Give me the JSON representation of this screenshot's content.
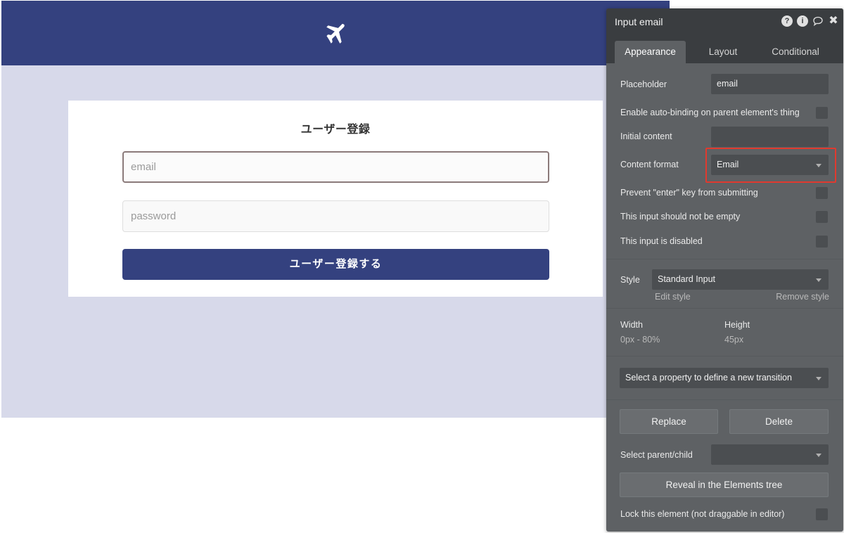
{
  "page": {
    "card_title": "ユーザー登録",
    "email_placeholder": "email",
    "password_placeholder": "password",
    "submit_label": "ユーザー登録する"
  },
  "panel": {
    "title": "Input email",
    "icons": [
      "question-icon",
      "info-icon",
      "comment-icon",
      "close-icon"
    ],
    "tabs": [
      "Appearance",
      "Layout",
      "Conditional"
    ],
    "active_tab": "Appearance",
    "placeholder_label": "Placeholder",
    "placeholder_value": "email",
    "auto_binding_label": "Enable auto-binding on parent element's thing",
    "initial_content_label": "Initial content",
    "initial_content_value": "",
    "content_format_label": "Content format",
    "content_format_value": "Email",
    "prevent_enter_label": "Prevent \"enter\" key from submitting",
    "not_empty_label": "This input should not be empty",
    "disabled_label": "This input is disabled",
    "style_label": "Style",
    "style_value": "Standard Input",
    "edit_style": "Edit style",
    "remove_style": "Remove style",
    "width_label": "Width",
    "width_value": "0px - 80%",
    "height_label": "Height",
    "height_value": "45px",
    "transition_placeholder": "Select a property to define a new transition",
    "replace_label": "Replace",
    "delete_label": "Delete",
    "parent_child_label": "Select parent/child",
    "reveal_label": "Reveal in the Elements tree",
    "lock_label": "Lock this element (not draggable in editor)"
  },
  "colors": {
    "header": "#34417f",
    "page_bg": "#d7d9ea",
    "panel_bg": "#5e6164",
    "panel_header": "#3a3d40",
    "highlight": "#e03a2f"
  }
}
